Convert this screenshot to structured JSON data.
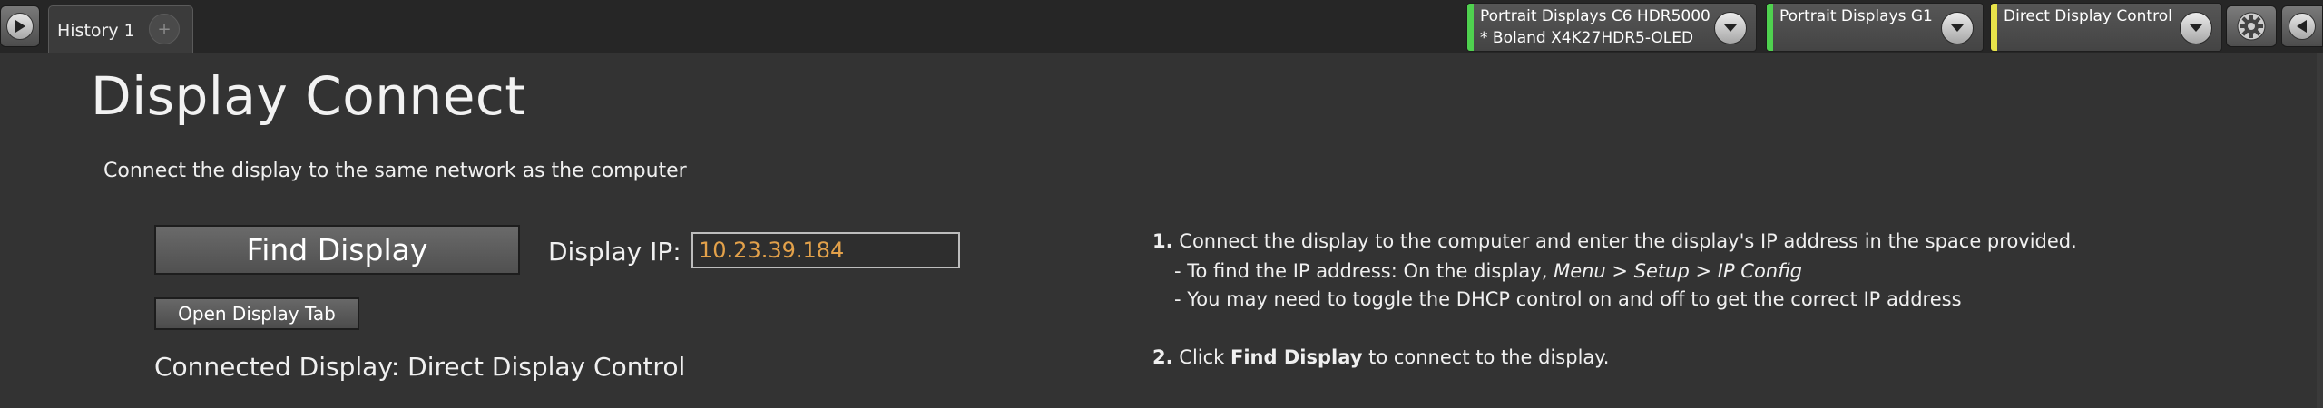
{
  "tabs": {
    "history_label": "History 1",
    "add_label": "+"
  },
  "devices": [
    {
      "line1": "Portrait Displays C6 HDR5000",
      "line2": "* Boland X4K27HDR5-OLED",
      "stripe_color": "#4fd14f"
    },
    {
      "line1": "Portrait Displays G1",
      "line2": "",
      "stripe_color": "#4fd14f"
    },
    {
      "line1": "Direct Display Control",
      "line2": "",
      "stripe_color": "#e8e34a"
    }
  ],
  "toolbar": {
    "play_icon": "play-icon",
    "settings_icon": "gear-icon",
    "collapse_icon": "chevron-left-icon"
  },
  "main": {
    "title": "Display Connect",
    "subtitle": "Connect the display to the same network as the computer",
    "find_label": "Find Display",
    "ip_label": "Display IP:",
    "ip_value": "10.23.39.184",
    "open_tab_label": "Open Display Tab",
    "connected_label": "Connected Display: Direct Display Control"
  },
  "instructions": {
    "step1_num": "1.",
    "step1_text": "Connect the display to the computer and enter the display's IP address in the space provided.",
    "step1_sub1_prefix": "- To find the IP address: On the display, ",
    "step1_sub1_path": "Menu > Setup > IP Config",
    "step1_sub2": "- You may need to toggle the DHCP control on and off to get the correct IP address",
    "step2_num": "2.",
    "step2_click": "Click ",
    "step2_bold": "Find Display",
    "step2_rest": " to connect to the display."
  },
  "colors": {
    "background": "#333333",
    "topbar": "#262626",
    "ip_text": "#e3a14a",
    "connected_stripe": "#4fd14f",
    "active_stripe": "#e8e34a"
  }
}
